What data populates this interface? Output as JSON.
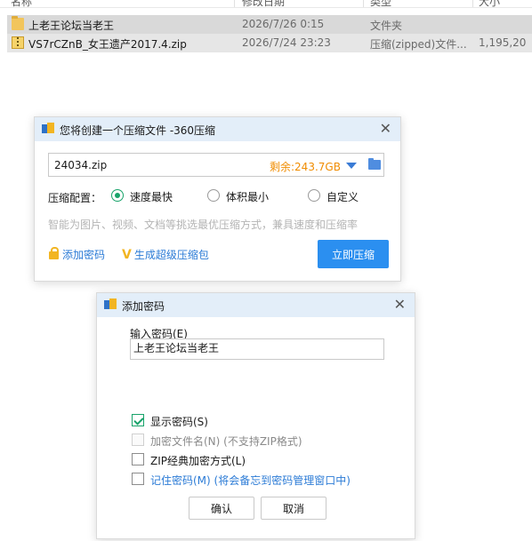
{
  "explorer": {
    "columns": [
      "名称",
      "修改日期",
      "类型",
      "大小"
    ],
    "files": [
      {
        "name": "上老王论坛当老王",
        "date": "2026/7/26 0:15",
        "type": "文件夹",
        "size": "",
        "icon": "folder-icon"
      },
      {
        "name": "VS7rCZnB_女王遗产2017.4.zip",
        "date": "2026/7/24 23:23",
        "type": "压缩(zipped)文件...",
        "size": "1,195,20",
        "icon": "zip-icon"
      }
    ]
  },
  "compress_dialog": {
    "title": "您将创建一个压缩文件 -360压缩",
    "filename": "24034.zip",
    "free_space": "剩余:243.7GB",
    "config_label": "压缩配置：",
    "options": [
      "速度最快",
      "体积最小",
      "自定义"
    ],
    "selected_option": "速度最快",
    "hint": "智能为图片、视频、文档等挑选最优压缩方式，兼具速度和压缩率",
    "add_password": "添加密码",
    "super_pack": "生成超级压缩包",
    "compress_button": "立即压缩"
  },
  "password_dialog": {
    "title": "添加密码",
    "input_label": "输入密码(E)",
    "password_value": "上老王论坛当老王",
    "show_password": "显示密码(S)",
    "encrypt_filenames": "加密文件名(N) (不支持ZIP格式)",
    "zip_classic": "ZIP经典加密方式(L)",
    "remember_password": "记住密码(M) (将会备忘到密码管理窗口中)",
    "ok_button": "确认",
    "cancel_button": "取消"
  },
  "colors": {
    "accent_blue": "#2b8ff0",
    "check_green": "#18a36a",
    "free_space_orange": "#f08c00",
    "titlebar": "#e3eef9"
  }
}
